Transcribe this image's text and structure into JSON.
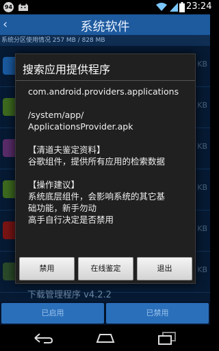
{
  "status_bar": {
    "badge": "94",
    "time": "23:24"
  },
  "app": {
    "title": "系统软件",
    "storage_text": "系统分区使用情况 257 MB / 828 MB",
    "background_list": {
      "sizes": [
        "KB",
        "KB",
        "KB",
        "KB",
        "KB",
        "KB"
      ],
      "partial_item": "下载管理程序 v4.2.2"
    },
    "actions": {
      "enabled_label": "已启用",
      "disabled_label": "已禁用"
    }
  },
  "dialog": {
    "title": "搜索应用提供程序",
    "package": "com.android.providers.applications",
    "path_line1": "/system/app/",
    "path_line2": "ApplicationsProvider.apk",
    "info_header": "【清道夫鉴定资料】",
    "info_text": "谷歌组件，提供所有应用的检索数据",
    "advice_header": "【操作建议】",
    "advice_line1": "系统底层组件，会影响系统的其它基",
    "advice_line2": "础功能，新手勿动",
    "advice_line3": "高手自行决定是否禁用",
    "buttons": {
      "disable": "禁用",
      "online_check": "在线鉴定",
      "exit": "退出"
    }
  },
  "colors": {
    "title_bar": "#1d5a9e",
    "list_bg": "#061a33",
    "action_btn": "#2a6fba"
  }
}
